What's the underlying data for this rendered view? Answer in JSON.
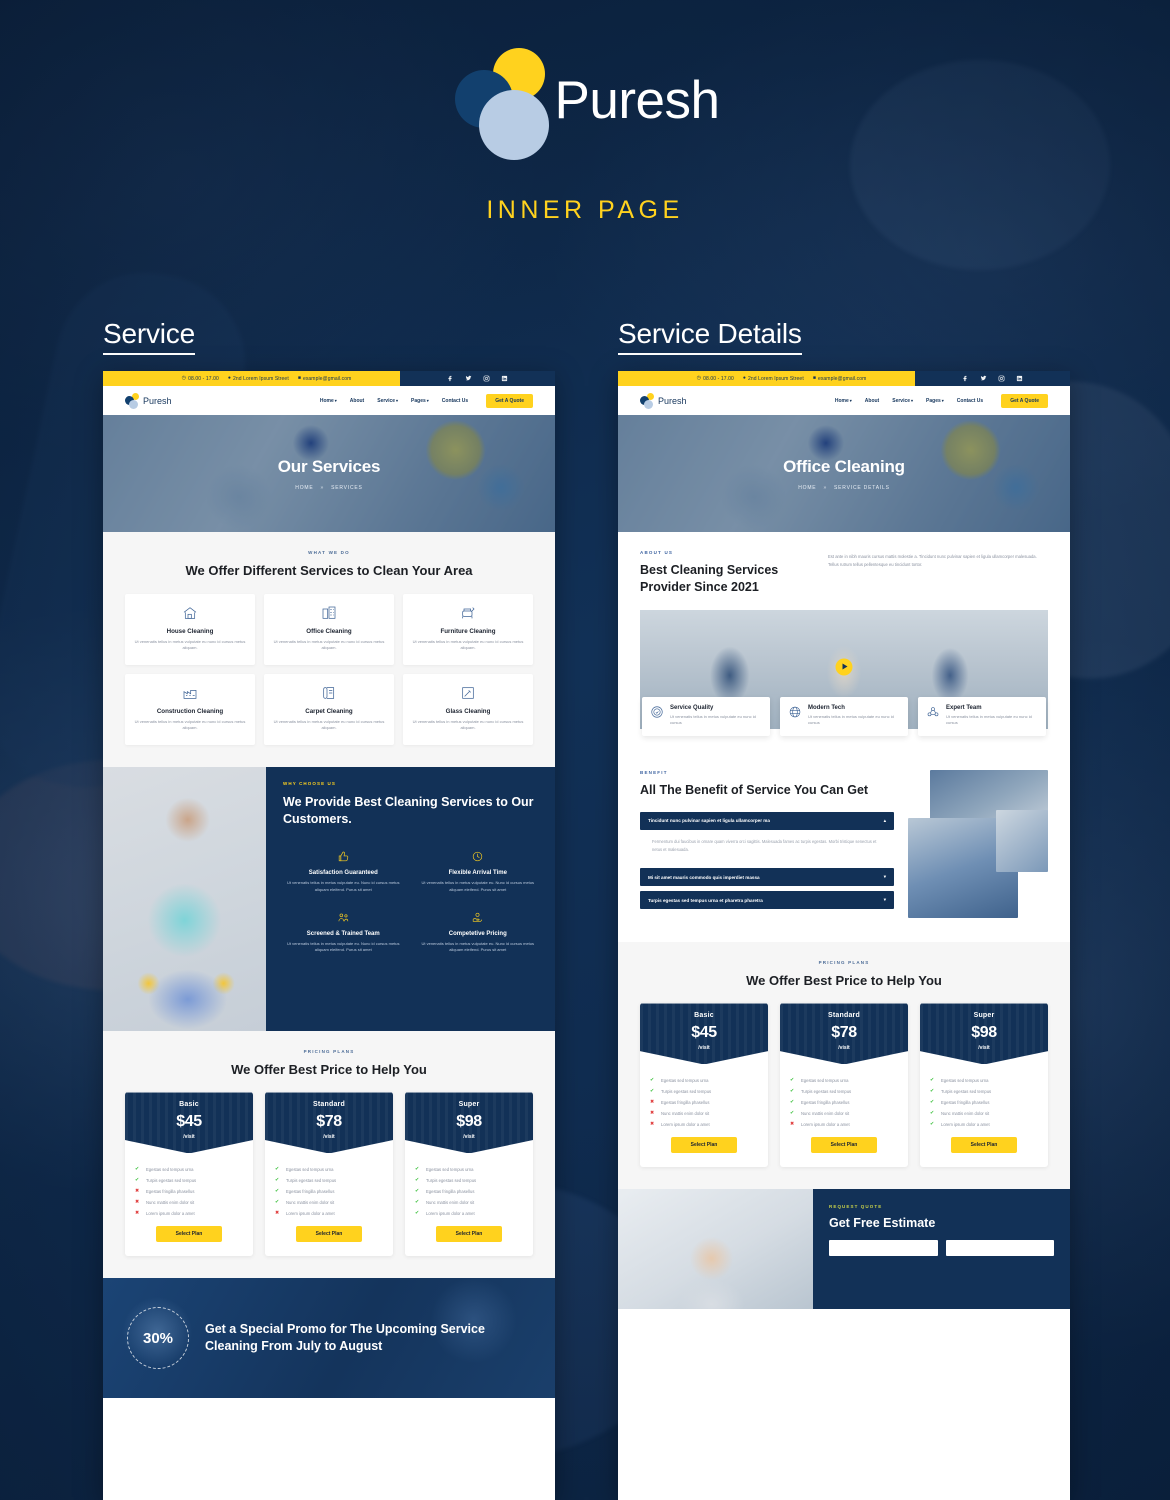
{
  "brand": {
    "name": "Puresh",
    "subtitle": "INNER PAGE"
  },
  "columns": {
    "left_heading": "Service",
    "right_heading": "Service Details"
  },
  "topbar": {
    "hours": "08.00 - 17.00",
    "address": "2nd Lorem Ipsum Street",
    "email": "example@gmail.com",
    "socials": [
      "facebook-icon",
      "twitter-icon",
      "instagram-icon",
      "linkedin-icon"
    ]
  },
  "nav": {
    "logo_text": "Puresh",
    "items": [
      "Home",
      "About",
      "Service",
      "Pages",
      "Contact Us"
    ],
    "cta": "Get A Quote"
  },
  "left_page": {
    "hero": {
      "title": "Our Services",
      "crumb_home": "HOME",
      "crumb_sep": "»",
      "crumb_current": "SERVICES"
    },
    "services": {
      "eyebrow": "WHAT WE DO",
      "title": "We Offer Different Services to Clean Your Area",
      "desc": "Ut venenatis tellus in metus vulputate eu nunc id cursus metus aliquam.",
      "cards": [
        {
          "name": "House Cleaning",
          "icon": "house-icon"
        },
        {
          "name": "Office Cleaning",
          "icon": "office-building-icon"
        },
        {
          "name": "Furniture Cleaning",
          "icon": "furniture-icon"
        },
        {
          "name": "Construction Cleaning",
          "icon": "factory-icon"
        },
        {
          "name": "Carpet Cleaning",
          "icon": "carpet-roll-icon"
        },
        {
          "name": "Glass Cleaning",
          "icon": "window-squeegee-icon"
        }
      ]
    },
    "why": {
      "eyebrow": "WHY CHOOSE US",
      "title": "We Provide Best Cleaning Services to Our Customers.",
      "desc": "Ut venenatis tellus in metus vulputate eu. Nunc id cursus metus aliquam eleifend. Purus sit amet",
      "items": [
        {
          "name": "Satisfaction Guaranteed",
          "icon": "thumbs-up-icon"
        },
        {
          "name": "Flexible Arrival Time",
          "icon": "clock-icon"
        },
        {
          "name": "Screened & Trained Team",
          "icon": "team-icon"
        },
        {
          "name": "Competetive Pricing",
          "icon": "hand-coin-icon"
        }
      ]
    },
    "promo": {
      "badge": "30%",
      "text": "Get a Special Promo for The Upcoming Service Cleaning From July to August"
    }
  },
  "right_page": {
    "hero": {
      "title": "Office Cleaning",
      "crumb_home": "HOME",
      "crumb_sep": "»",
      "crumb_current": "SERVICE DETAILS"
    },
    "about": {
      "eyebrow": "ABOUT US",
      "title": "Best Cleaning Services Provider Since 2021",
      "body": "Est ante in nibh mauris cursus mattis molestie a. Tincidunt nunc pulvinar sapien et ligula ullamcorper malesuada. Tellus rutrum tellus pellentesque eu tincidunt tortor."
    },
    "video": {
      "play_icon": "play-icon"
    },
    "features": [
      {
        "name": "Service Quality",
        "icon": "quality-badge-icon",
        "desc": "Ut venenatis tellus in metus vulputate eu nunc id cursus"
      },
      {
        "name": "Modern Tech",
        "icon": "globe-network-icon",
        "desc": "Ut venenatis tellus in metus vulputate eu nunc id cursus"
      },
      {
        "name": "Expert Team",
        "icon": "team-network-icon",
        "desc": "Ut venenatis tellus in metus vulputate eu nunc id cursus"
      }
    ],
    "benefit": {
      "eyebrow": "BENEFIT",
      "title": "All The Benefit of Service You Can Get",
      "accordion": [
        {
          "heading": "Tincidunt nunc pulvinar sapien et ligula ullamcorper ma",
          "open": true,
          "body": "Fermentum dui faucibus in ornare quam viverra orci sagittis. Malesuada fames ac turpis egestas. Morbi tristique senectus et netus et malesuada."
        },
        {
          "heading": "Mi sit amet mauris commodo quis imperdiet massa",
          "open": false,
          "body": ""
        },
        {
          "heading": "Turpis egestas sed tempus urna et pharetra pharetra",
          "open": false,
          "body": ""
        }
      ]
    },
    "quote": {
      "eyebrow": "REQUEST QUOTE",
      "title": "Get Free Estimate"
    }
  },
  "pricing": {
    "eyebrow": "PRICING PLANS",
    "title": "We Offer Best Price to Help You",
    "per": "/visit",
    "button": "Select Plan",
    "plans": [
      {
        "name": "Basic",
        "price": "$45",
        "features": [
          true,
          true,
          false,
          false,
          false
        ]
      },
      {
        "name": "Standard",
        "price": "$78",
        "features": [
          true,
          true,
          true,
          true,
          false
        ]
      },
      {
        "name": "Super",
        "price": "$98",
        "features": [
          true,
          true,
          true,
          true,
          true
        ]
      }
    ],
    "feature_labels": [
      "Egestas sed tempus urna",
      "Turpis egestas sed tempus",
      "Egestas fringilla phasellus",
      "Nunc mattis enim dolor sit",
      "Lorem ipsum dolor a amet"
    ],
    "mark_yes": "✔",
    "mark_no": "✖"
  },
  "colors": {
    "navy": "#123157",
    "yellow": "#ffd21e",
    "light_blue": "#b8cce4",
    "page_bg": "#0e2443"
  }
}
